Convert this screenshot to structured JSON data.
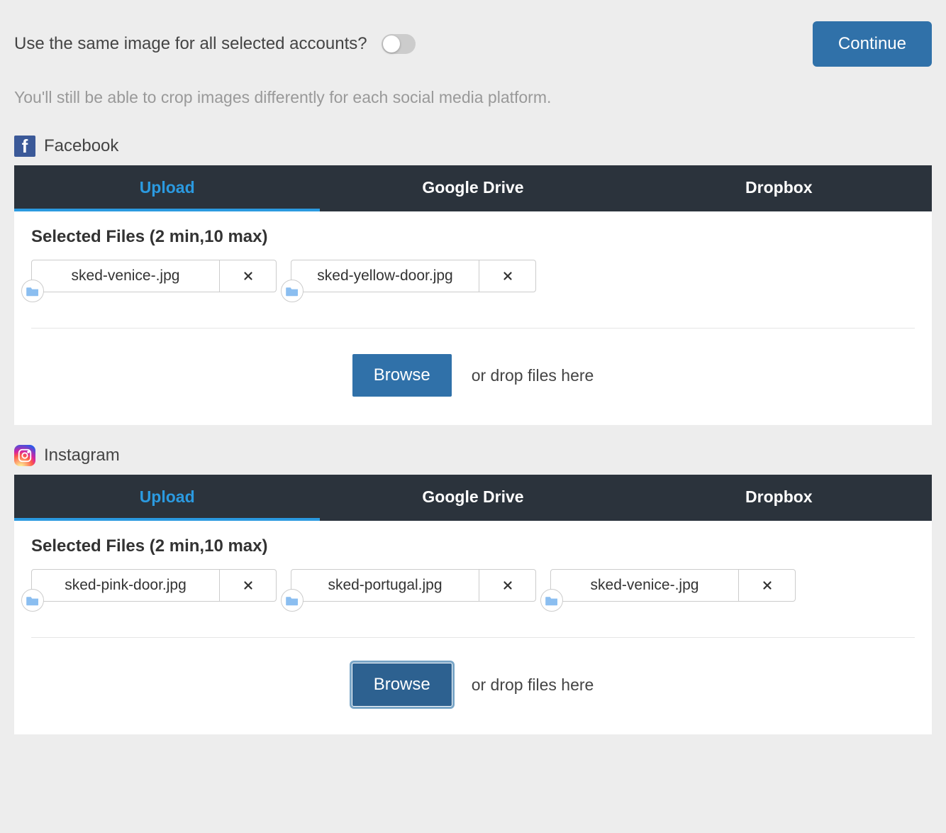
{
  "header": {
    "toggle_label": "Use the same image for all selected accounts?",
    "continue_label": "Continue",
    "subhint": "You'll still be able to crop images differently for each social media platform."
  },
  "tabs": {
    "upload": "Upload",
    "gdrive": "Google Drive",
    "dropbox": "Dropbox"
  },
  "common": {
    "selected_title": "Selected Files (2 min,10 max)",
    "browse_label": "Browse",
    "drop_hint": "or drop files here"
  },
  "sections": {
    "facebook": {
      "label": "Facebook",
      "files": [
        {
          "name": "sked-venice-.jpg"
        },
        {
          "name": "sked-yellow-door.jpg"
        }
      ]
    },
    "instagram": {
      "label": "Instagram",
      "files": [
        {
          "name": "sked-pink-door.jpg"
        },
        {
          "name": "sked-portugal.jpg"
        },
        {
          "name": "sked-venice-.jpg"
        }
      ]
    }
  }
}
